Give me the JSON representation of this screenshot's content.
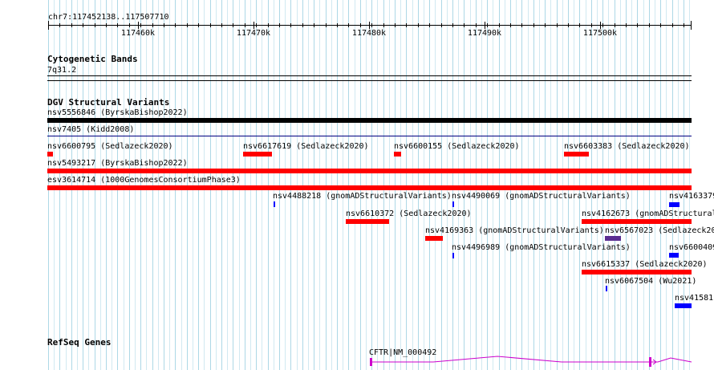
{
  "location": "chr7:117452138..117507710",
  "ruler": {
    "ticks": [
      "117460k",
      "117470k",
      "117480k",
      "117490k",
      "117500k"
    ]
  },
  "tracks": {
    "cytobands": {
      "title": "Cytogenetic Bands",
      "band": "7q31.2"
    },
    "dgv": {
      "title": "DGV Structural Variants"
    },
    "refseq": {
      "title": "RefSeq Genes"
    }
  },
  "colors": {
    "loss": "#ff0000",
    "gain": "#0000ff",
    "complex": "#5a2d91",
    "dark": "#000000",
    "thin": "#000080",
    "gene": "#cc00cc",
    "grid": "#add8e6"
  },
  "features": [
    {
      "id": "f1",
      "label": "nsv5556846 (ByrskaBishop2022)"
    },
    {
      "id": "f2",
      "label": "nsv7405 (Kidd2008)"
    },
    {
      "id": "f3",
      "label": "nsv6600795 (Sedlazeck2020)"
    },
    {
      "id": "f4",
      "label": "nsv6617619 (Sedlazeck2020)"
    },
    {
      "id": "f5",
      "label": "nsv6600155 (Sedlazeck2020)"
    },
    {
      "id": "f6",
      "label": "nsv6603383 (Sedlazeck2020)"
    },
    {
      "id": "f7",
      "label": "nsv5493217 (ByrskaBishop2022)"
    },
    {
      "id": "f8",
      "label": "esv3614714 (1000GenomesConsortiumPhase3)"
    },
    {
      "id": "f9",
      "label": "nsv4488218 (gnomADStructuralVariants)"
    },
    {
      "id": "f10",
      "label": "nsv4490069 (gnomADStructuralVariants)"
    },
    {
      "id": "f11",
      "label": "nsv4163379"
    },
    {
      "id": "f12",
      "label": "nsv6610372 (Sedlazeck2020)"
    },
    {
      "id": "f13",
      "label": "nsv4162673 (gnomADStructural"
    },
    {
      "id": "f14",
      "label": "nsv4169363 (gnomADStructuralVariants)"
    },
    {
      "id": "f15",
      "label": "nsv6567023 (Sedlazeck20"
    },
    {
      "id": "f16",
      "label": "nsv4496989 (gnomADStructuralVariants)"
    },
    {
      "id": "f17",
      "label": "nsv6600409"
    },
    {
      "id": "f18",
      "label": "nsv6615337 (Sedlazeck2020)"
    },
    {
      "id": "f19",
      "label": "nsv6067504 (Wu2021)"
    },
    {
      "id": "f20",
      "label": "nsv41581"
    }
  ],
  "gene": {
    "label": "CFTR|NM_000492"
  }
}
